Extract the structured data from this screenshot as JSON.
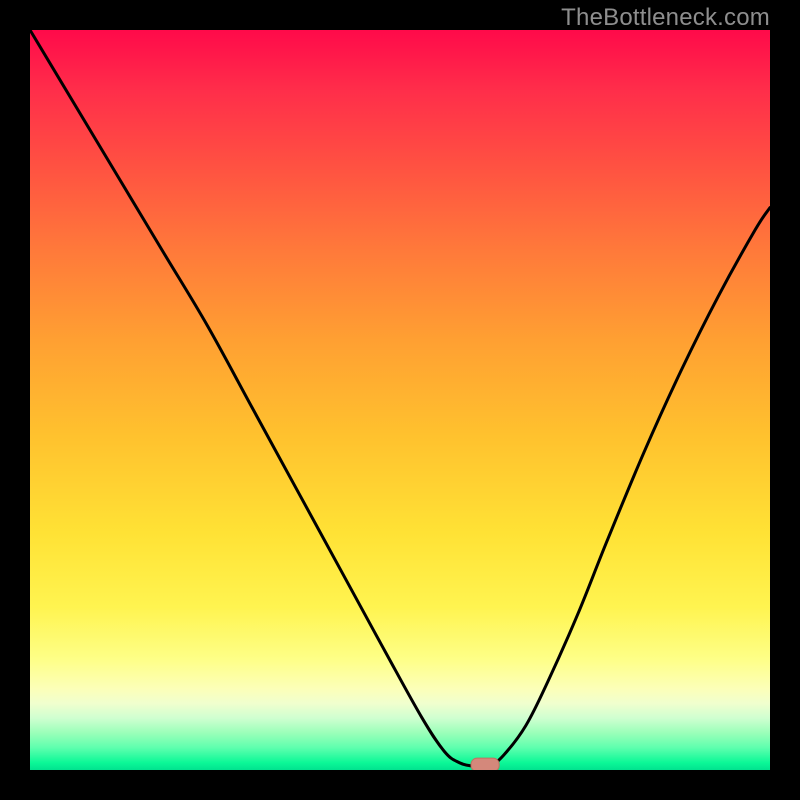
{
  "watermark": {
    "text": "TheBottleneck.com"
  },
  "colors": {
    "background": "#000000",
    "curve": "#000000",
    "marker_fill": "#d4887b",
    "marker_stroke": "#c07060"
  },
  "chart_data": {
    "type": "line",
    "title": "",
    "xlabel": "",
    "ylabel": "",
    "xlim": [
      0,
      100
    ],
    "ylim": [
      0,
      100
    ],
    "grid": false,
    "legend": false,
    "series": [
      {
        "name": "bottleneck-curve",
        "x": [
          0,
          6,
          12,
          18,
          24,
          30,
          36,
          42,
          48,
          53,
          56,
          58,
          60,
          62,
          64,
          67,
          70,
          74,
          78,
          83,
          88,
          93,
          98,
          100
        ],
        "values": [
          100,
          90,
          80,
          70,
          60,
          49,
          38,
          27,
          16,
          7,
          2.5,
          1,
          0.5,
          0.5,
          2,
          6,
          12,
          21,
          31,
          43,
          54,
          64,
          73,
          76
        ]
      }
    ],
    "marker": {
      "shape": "rounded-rect",
      "x": 61.5,
      "y": 0.7,
      "width_pct": 3.8,
      "height_pct": 1.8
    }
  }
}
